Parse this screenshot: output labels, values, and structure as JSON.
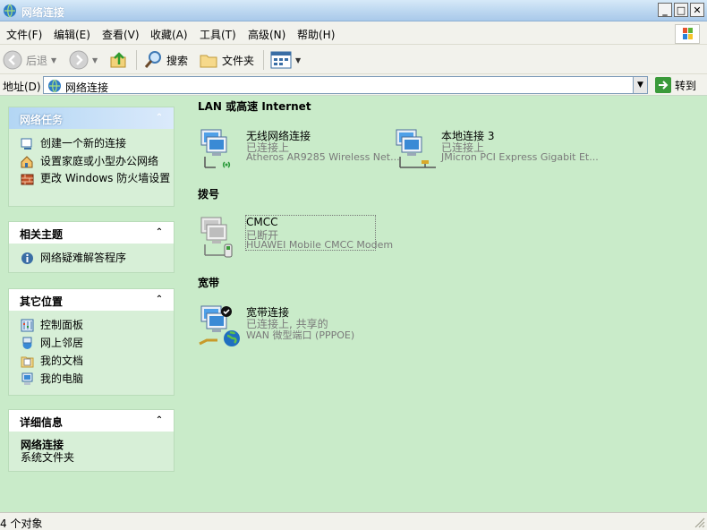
{
  "window": {
    "title": "网络连接"
  },
  "menu": [
    "文件(F)",
    "编辑(E)",
    "查看(V)",
    "收藏(A)",
    "工具(T)",
    "高级(N)",
    "帮助(H)"
  ],
  "toolbar": {
    "back": "后退",
    "search": "搜索",
    "folders": "文件夹"
  },
  "address": {
    "label": "地址(D)",
    "value": "网络连接",
    "go": "转到"
  },
  "panels": {
    "tasks": {
      "title": "网络任务",
      "items": [
        "创建一个新的连接",
        "设置家庭或小型办公网络",
        "更改 Windows 防火墙设置"
      ]
    },
    "related": {
      "title": "相关主题",
      "items": [
        "网络疑难解答程序"
      ]
    },
    "other": {
      "title": "其它位置",
      "items": [
        "控制面板",
        "网上邻居",
        "我的文档",
        "我的电脑"
      ]
    },
    "details": {
      "title": "详细信息",
      "name": "网络连接",
      "type": "系统文件夹"
    }
  },
  "sections": {
    "lan": {
      "title": "LAN 或高速 Internet"
    },
    "dialup": {
      "title": "拨号"
    },
    "broadband": {
      "title": "宽带"
    }
  },
  "connections": {
    "wireless": {
      "name": "无线网络连接",
      "status": "已连接上",
      "device": "Atheros AR9285 Wireless Net..."
    },
    "local3": {
      "name": "本地连接 3",
      "status": "已连接上",
      "device": "JMicron PCI Express Gigabit Et..."
    },
    "cmcc": {
      "name": "CMCC",
      "status": "已断开",
      "device": "HUAWEI Mobile CMCC Modem"
    },
    "broadband": {
      "name": "宽带连接",
      "status": "已连接上, 共享的",
      "device": "WAN 微型端口 (PPPOE)"
    }
  },
  "status": {
    "text": "4 个对象"
  }
}
